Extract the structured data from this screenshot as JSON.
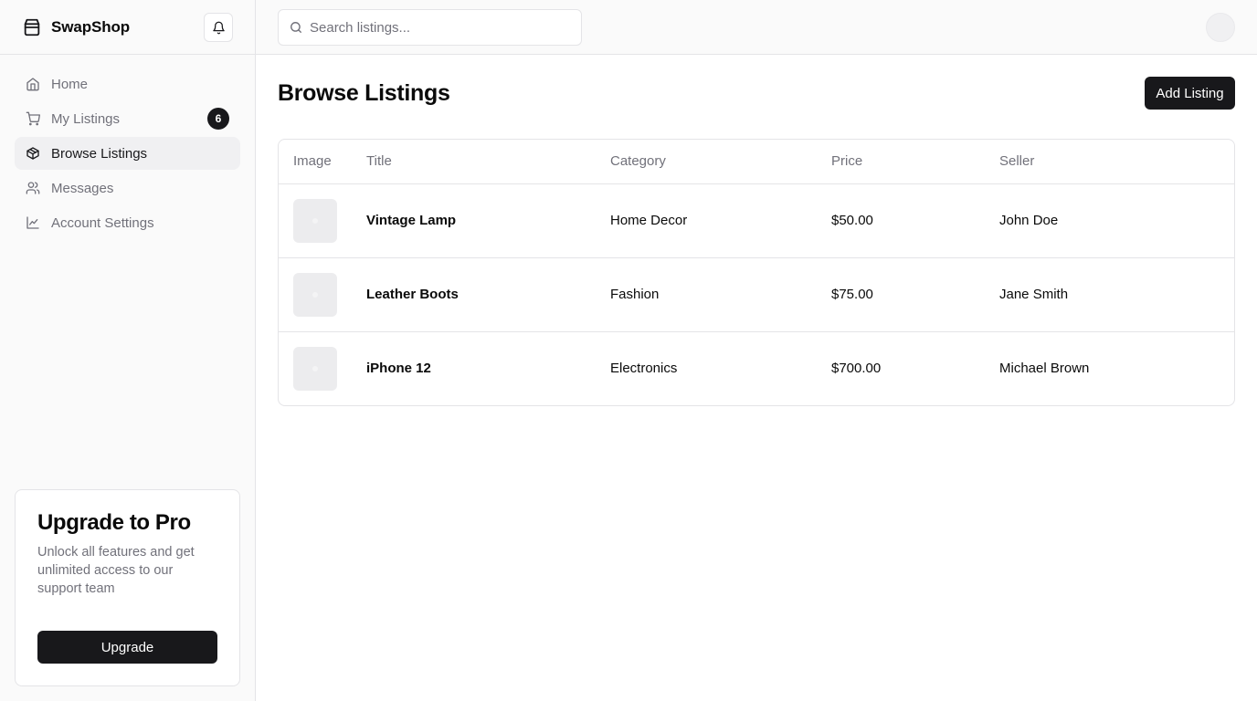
{
  "brand": {
    "name": "SwapShop",
    "icon": "shopping-bag-icon"
  },
  "sidebar": {
    "items": [
      {
        "label": "Home",
        "icon": "home-icon",
        "active": false
      },
      {
        "label": "My Listings",
        "icon": "cart-icon",
        "active": false,
        "badge": "6"
      },
      {
        "label": "Browse Listings",
        "icon": "package-icon",
        "active": true
      },
      {
        "label": "Messages",
        "icon": "users-icon",
        "active": false
      },
      {
        "label": "Account Settings",
        "icon": "line-chart-icon",
        "active": false
      }
    ],
    "upgrade": {
      "title": "Upgrade to Pro",
      "description": "Unlock all features and get unlimited access to our support team",
      "button_label": "Upgrade"
    }
  },
  "header": {
    "search_placeholder": "Search listings...",
    "search_value": ""
  },
  "main": {
    "title": "Browse Listings",
    "add_button_label": "Add Listing",
    "table": {
      "columns": [
        "Image",
        "Title",
        "Category",
        "Price",
        "Seller"
      ],
      "rows": [
        {
          "title": "Vintage Lamp",
          "category": "Home Decor",
          "price": "$50.00",
          "seller": "John Doe"
        },
        {
          "title": "Leather Boots",
          "category": "Fashion",
          "price": "$75.00",
          "seller": "Jane Smith"
        },
        {
          "title": "iPhone 12",
          "category": "Electronics",
          "price": "$700.00",
          "seller": "Michael Brown"
        }
      ]
    }
  },
  "colors": {
    "primary": "#18181b",
    "muted_text": "#71717a",
    "border": "#e4e4e7",
    "sidebar_bg": "#fafafa",
    "active_bg": "#f0f0f2"
  }
}
